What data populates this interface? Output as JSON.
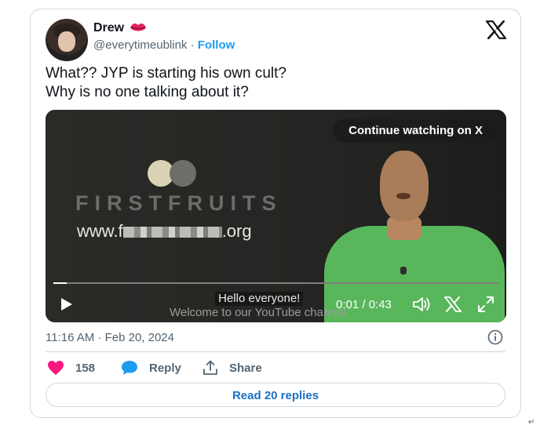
{
  "tweet": {
    "author_name": "Drew",
    "handle": "@everytimeublink",
    "separator": "·",
    "follow_label": "Follow",
    "text_line1": "What?? JYP is starting his own cult?",
    "text_line2": "Why is no one talking about it?",
    "timestamp": "11:16 AM · Feb 20, 2024"
  },
  "video": {
    "continue_label": "Continue watching on X",
    "brand_text": "FIRSTFRUITS",
    "url_prefix": "www.f",
    "url_suffix": ".org",
    "caption_line1": "Hello everyone!",
    "caption_line2": "Welcome to our YouTube channel.",
    "timecode": "0:01 / 0:43",
    "progress_fraction": 0.03
  },
  "actions": {
    "like_count": "158",
    "reply_label": "Reply",
    "share_label": "Share"
  },
  "footer": {
    "read_replies_label": "Read 20 replies"
  },
  "colors": {
    "accent": "#1d9bf0",
    "like": "#f91880",
    "reply_icon": "#1d9bf0"
  },
  "icons": [
    "lips-emoji-icon",
    "x-logo-icon",
    "play-icon",
    "volume-icon",
    "x-small-icon",
    "expand-icon",
    "info-icon",
    "heart-icon",
    "reply-bubble-icon",
    "share-icon"
  ],
  "doc_mark": "↵"
}
